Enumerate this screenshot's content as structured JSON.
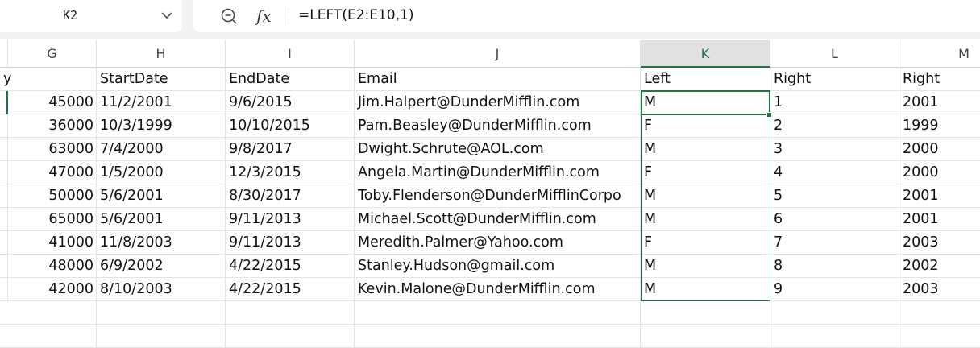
{
  "formula_bar": {
    "name_box": "K2",
    "fx_label": "fx",
    "formula": "=LEFT(E2:E10,1)"
  },
  "columns": {
    "partial_left": "",
    "G": "G",
    "H": "H",
    "I": "I",
    "J": "J",
    "K": "K",
    "L": "L",
    "M": "M"
  },
  "header_row": {
    "col_prev": "y",
    "H": "StartDate",
    "I": "EndDate",
    "J": "Email",
    "K": "Left",
    "L": "Right",
    "M": "Right"
  },
  "rows": [
    {
      "G": "45000",
      "H": "11/2/2001",
      "I": "9/6/2015",
      "J": "Jim.Halpert@DunderMifflin.com",
      "K": "M",
      "L": "1",
      "M": "2001"
    },
    {
      "G": "36000",
      "H": "10/3/1999",
      "I": "10/10/2015",
      "J": "Pam.Beasley@DunderMifflin.com",
      "K": "F",
      "L": "2",
      "M": "1999"
    },
    {
      "G": "63000",
      "H": "7/4/2000",
      "I": "9/8/2017",
      "J": "Dwight.Schrute@AOL.com",
      "K": "M",
      "L": "3",
      "M": "2000"
    },
    {
      "G": "47000",
      "H": "1/5/2000",
      "I": "12/3/2015",
      "J": "Angela.Martin@DunderMifflin.com",
      "K": "F",
      "L": "4",
      "M": "2000"
    },
    {
      "G": "50000",
      "H": "5/6/2001",
      "I": "8/30/2017",
      "J": "Toby.Flenderson@DunderMifflinCorpo",
      "K": "M",
      "L": "5",
      "M": "2001"
    },
    {
      "G": "65000",
      "H": "5/6/2001",
      "I": "9/11/2013",
      "J": "Michael.Scott@DunderMifflin.com",
      "K": "M",
      "L": "6",
      "M": "2001"
    },
    {
      "G": "41000",
      "H": "11/8/2003",
      "I": "9/11/2013",
      "J": "Meredith.Palmer@Yahoo.com",
      "K": "F",
      "L": "7",
      "M": "2003"
    },
    {
      "G": "48000",
      "H": "6/9/2002",
      "I": "4/22/2015",
      "J": "Stanley.Hudson@gmail.com",
      "K": "M",
      "L": "8",
      "M": "2002"
    },
    {
      "G": "42000",
      "H": "8/10/2003",
      "I": "4/22/2015",
      "J": "Kevin.Malone@DunderMifflin.com",
      "K": "M",
      "L": "9",
      "M": "2003"
    }
  ],
  "colors": {
    "accent": "#217346",
    "gridline": "#e4e4e4",
    "header_bg": "#f3f3f3"
  }
}
